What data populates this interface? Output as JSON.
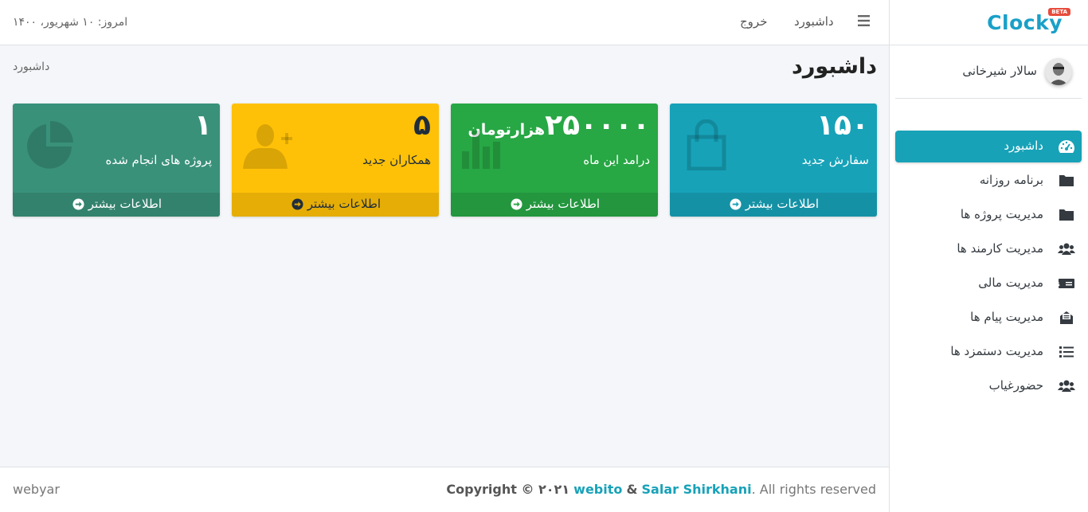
{
  "brand": {
    "logo_text": "Clocky",
    "beta_badge": "BETA"
  },
  "user": {
    "name": "سالار شیرخانی"
  },
  "sidebar": {
    "items": [
      {
        "label": "داشبورد",
        "icon": "tachometer-icon",
        "active": true
      },
      {
        "label": "برنامه روزانه",
        "icon": "folder-icon"
      },
      {
        "label": "مدیریت پروژه ها",
        "icon": "folder-icon"
      },
      {
        "label": "مدیریت کارمند ها",
        "icon": "users-icon"
      },
      {
        "label": "مدیریت مالی",
        "icon": "money-bill-icon"
      },
      {
        "label": "مدیریت پیام ها",
        "icon": "envelope-open-icon"
      },
      {
        "label": "مدیریت دستمزد ها",
        "icon": "list-icon"
      },
      {
        "label": "حضورغیاب",
        "icon": "users-icon"
      }
    ]
  },
  "topbar": {
    "dashboard_link": "داشبورد",
    "logout_link": "خروج",
    "date": "امروز: ۱۰ شهریور، ۱۴۰۰"
  },
  "header": {
    "title": "داشبورد",
    "breadcrumb": "داشبورد"
  },
  "boxes": [
    {
      "value": "۱۵۰",
      "unit": "",
      "label": "سفارش جدید",
      "footer": "اطلاعات بیشتر",
      "icon": "shopping-bag-icon",
      "color": "#17a2b8"
    },
    {
      "value": "۲۵۰۰۰۰",
      "unit": "هزارتومان",
      "label": "درامد این ماه",
      "footer": "اطلاعات بیشتر",
      "icon": "bar-chart-icon",
      "color": "#28a745"
    },
    {
      "value": "۵",
      "unit": "",
      "label": "همکاران جدید",
      "footer": "اطلاعات بیشتر",
      "icon": "user-plus-icon",
      "color": "#ffc107"
    },
    {
      "value": "۱",
      "unit": "",
      "label": "پروژه های انجام شده",
      "footer": "اطلاعات بیشتر",
      "icon": "pie-chart-icon",
      "color": "#39917a"
    }
  ],
  "footer": {
    "left": "webyar",
    "copyright": "Copyright © ۲۰۲۱",
    "link1": "webito",
    "amp": "&",
    "link2": "Salar Shirkhani",
    "rights": ". All rights reserved"
  }
}
